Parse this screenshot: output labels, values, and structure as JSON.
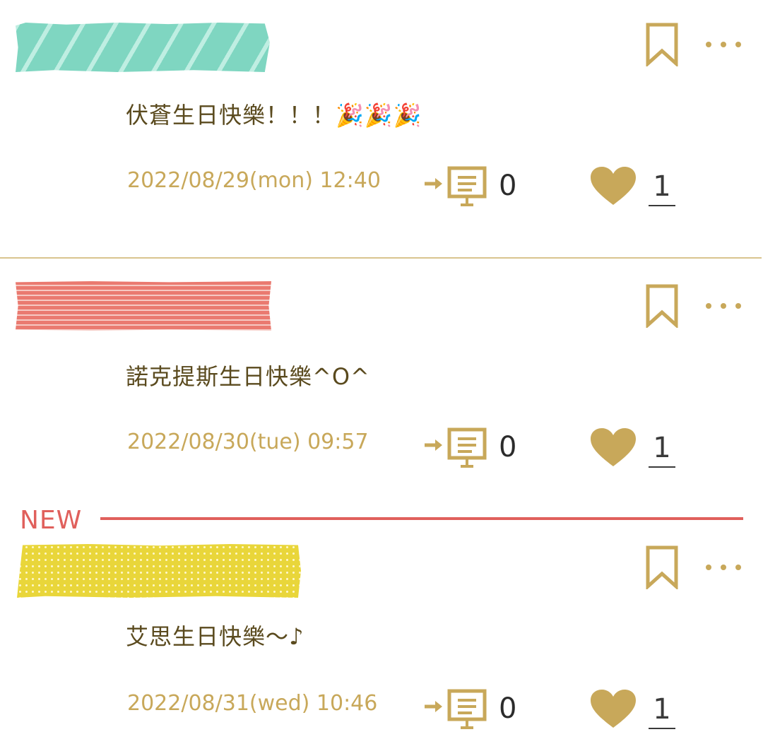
{
  "posts": [
    {
      "message": "伏蒼生日快樂！！！🎉🎉🎉",
      "timestamp": "2022/08/29(mon) 12:40",
      "replies": "0",
      "likes": "1",
      "tape_style": "teal-diagonal-stripes"
    },
    {
      "message": "諾克提斯生日快樂^O^",
      "timestamp": "2022/08/30(tue) 09:57",
      "replies": "0",
      "likes": "1",
      "tape_style": "red-horizontal-stripes"
    },
    {
      "message": "艾思生日快樂～♪",
      "timestamp": "2022/08/31(wed) 10:46",
      "replies": "0",
      "likes": "1",
      "tape_style": "yellow-dots"
    }
  ],
  "new_marker": "NEW",
  "icons": {
    "bookmark": "bookmark-icon",
    "more": "more-icon",
    "reply": "reply-icon",
    "like": "heart-icon"
  },
  "colors": {
    "accent_gold": "#c8a85a",
    "text_brown": "#5a4a1e",
    "new_red": "#e0605c"
  }
}
